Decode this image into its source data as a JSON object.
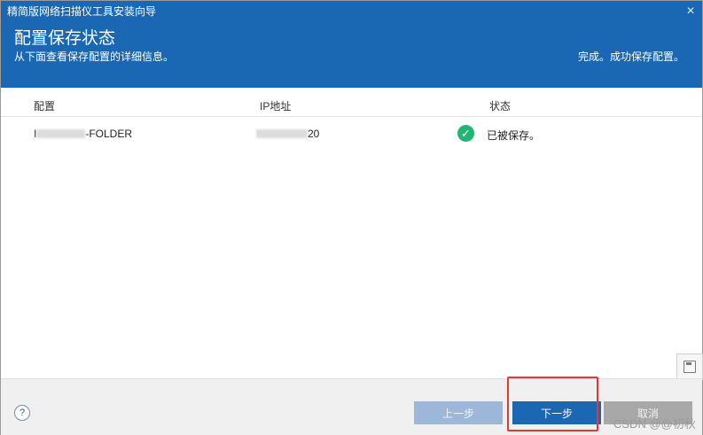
{
  "window": {
    "title": "精简版网络扫描仪工具安装向导",
    "close_symbol": "×"
  },
  "header": {
    "heading": "配置保存状态",
    "subtext": "从下面查看保存配置的详细信息。",
    "status": "完成。成功保存配置。"
  },
  "table": {
    "columns": [
      "配置",
      "IP地址",
      "状态"
    ],
    "rows": [
      {
        "config_prefix": "I",
        "config_suffix": "-FOLDER",
        "ip_suffix": "20",
        "status": "已被保存。",
        "status_icon": "checkmark-icon",
        "status_color": "#22b573"
      }
    ]
  },
  "footer": {
    "help_symbol": "?",
    "prev_label": "上一步",
    "next_label": "下一步",
    "cancel_label": "取消"
  },
  "watermark": "CSDN @@初秋",
  "colors": {
    "header_bg": "#1a67b3",
    "primary_button": "#1a67b3",
    "disabled_button": "#9cb7d8",
    "cancel_button": "#a8a8a8",
    "highlight": "#e23a33"
  }
}
